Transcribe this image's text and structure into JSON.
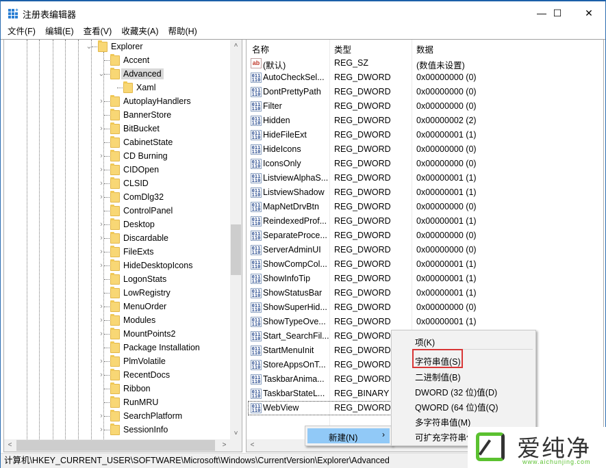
{
  "window": {
    "title": "注册表编辑器",
    "controls": {
      "minimize": "—",
      "maximize": "☐",
      "close": "✕"
    }
  },
  "menubar": [
    {
      "label": "文件(F)"
    },
    {
      "label": "编辑(E)"
    },
    {
      "label": "查看(V)"
    },
    {
      "label": "收藏夹(A)"
    },
    {
      "label": "帮助(H)"
    }
  ],
  "tree": {
    "items": [
      {
        "label": "Explorer",
        "level": 0,
        "expander": "expanded"
      },
      {
        "label": "Accent",
        "level": 1,
        "expander": "none"
      },
      {
        "label": "Advanced",
        "level": 1,
        "expander": "expanded",
        "selected": true
      },
      {
        "label": "Xaml",
        "level": 2,
        "expander": "none"
      },
      {
        "label": "AutoplayHandlers",
        "level": 1,
        "expander": "collapsed"
      },
      {
        "label": "BannerStore",
        "level": 1,
        "expander": "none"
      },
      {
        "label": "BitBucket",
        "level": 1,
        "expander": "collapsed"
      },
      {
        "label": "CabinetState",
        "level": 1,
        "expander": "none"
      },
      {
        "label": "CD Burning",
        "level": 1,
        "expander": "collapsed"
      },
      {
        "label": "CIDOpen",
        "level": 1,
        "expander": "collapsed"
      },
      {
        "label": "CLSID",
        "level": 1,
        "expander": "collapsed"
      },
      {
        "label": "ComDlg32",
        "level": 1,
        "expander": "collapsed"
      },
      {
        "label": "ControlPanel",
        "level": 1,
        "expander": "none"
      },
      {
        "label": "Desktop",
        "level": 1,
        "expander": "collapsed"
      },
      {
        "label": "Discardable",
        "level": 1,
        "expander": "collapsed"
      },
      {
        "label": "FileExts",
        "level": 1,
        "expander": "collapsed"
      },
      {
        "label": "HideDesktopIcons",
        "level": 1,
        "expander": "collapsed"
      },
      {
        "label": "LogonStats",
        "level": 1,
        "expander": "none"
      },
      {
        "label": "LowRegistry",
        "level": 1,
        "expander": "none"
      },
      {
        "label": "MenuOrder",
        "level": 1,
        "expander": "collapsed"
      },
      {
        "label": "Modules",
        "level": 1,
        "expander": "collapsed"
      },
      {
        "label": "MountPoints2",
        "level": 1,
        "expander": "collapsed"
      },
      {
        "label": "Package Installation",
        "level": 1,
        "expander": "none"
      },
      {
        "label": "PlmVolatile",
        "level": 1,
        "expander": "collapsed"
      },
      {
        "label": "RecentDocs",
        "level": 1,
        "expander": "collapsed"
      },
      {
        "label": "Ribbon",
        "level": 1,
        "expander": "none"
      },
      {
        "label": "RunMRU",
        "level": 1,
        "expander": "none"
      },
      {
        "label": "SearchPlatform",
        "level": 1,
        "expander": "collapsed"
      },
      {
        "label": "SessionInfo",
        "level": 1,
        "expander": "collapsed"
      }
    ]
  },
  "list": {
    "columns": {
      "name": "名称",
      "type": "类型",
      "data": "数据"
    },
    "rows": [
      {
        "icon": "string-value-icon",
        "name": "(默认)",
        "type": "REG_SZ",
        "data": "(数值未设置)"
      },
      {
        "icon": "binary-value-icon",
        "name": "AutoCheckSel...",
        "type": "REG_DWORD",
        "data": "0x00000000 (0)"
      },
      {
        "icon": "binary-value-icon",
        "name": "DontPrettyPath",
        "type": "REG_DWORD",
        "data": "0x00000000 (0)"
      },
      {
        "icon": "binary-value-icon",
        "name": "Filter",
        "type": "REG_DWORD",
        "data": "0x00000000 (0)"
      },
      {
        "icon": "binary-value-icon",
        "name": "Hidden",
        "type": "REG_DWORD",
        "data": "0x00000002 (2)"
      },
      {
        "icon": "binary-value-icon",
        "name": "HideFileExt",
        "type": "REG_DWORD",
        "data": "0x00000001 (1)"
      },
      {
        "icon": "binary-value-icon",
        "name": "HideIcons",
        "type": "REG_DWORD",
        "data": "0x00000000 (0)"
      },
      {
        "icon": "binary-value-icon",
        "name": "IconsOnly",
        "type": "REG_DWORD",
        "data": "0x00000000 (0)"
      },
      {
        "icon": "binary-value-icon",
        "name": "ListviewAlphaS...",
        "type": "REG_DWORD",
        "data": "0x00000001 (1)"
      },
      {
        "icon": "binary-value-icon",
        "name": "ListviewShadow",
        "type": "REG_DWORD",
        "data": "0x00000001 (1)"
      },
      {
        "icon": "binary-value-icon",
        "name": "MapNetDrvBtn",
        "type": "REG_DWORD",
        "data": "0x00000000 (0)"
      },
      {
        "icon": "binary-value-icon",
        "name": "ReindexedProf...",
        "type": "REG_DWORD",
        "data": "0x00000001 (1)"
      },
      {
        "icon": "binary-value-icon",
        "name": "SeparateProce...",
        "type": "REG_DWORD",
        "data": "0x00000000 (0)"
      },
      {
        "icon": "binary-value-icon",
        "name": "ServerAdminUI",
        "type": "REG_DWORD",
        "data": "0x00000000 (0)"
      },
      {
        "icon": "binary-value-icon",
        "name": "ShowCompCol...",
        "type": "REG_DWORD",
        "data": "0x00000001 (1)"
      },
      {
        "icon": "binary-value-icon",
        "name": "ShowInfoTip",
        "type": "REG_DWORD",
        "data": "0x00000001 (1)"
      },
      {
        "icon": "binary-value-icon",
        "name": "ShowStatusBar",
        "type": "REG_DWORD",
        "data": "0x00000001 (1)"
      },
      {
        "icon": "binary-value-icon",
        "name": "ShowSuperHid...",
        "type": "REG_DWORD",
        "data": "0x00000000 (0)"
      },
      {
        "icon": "binary-value-icon",
        "name": "ShowTypeOve...",
        "type": "REG_DWORD",
        "data": "0x00000001 (1)"
      },
      {
        "icon": "binary-value-icon",
        "name": "Start_SearchFil...",
        "type": "REG_DWORD",
        "data": ""
      },
      {
        "icon": "binary-value-icon",
        "name": "StartMenuInit",
        "type": "REG_DWORD",
        "data": ""
      },
      {
        "icon": "binary-value-icon",
        "name": "StoreAppsOnT...",
        "type": "REG_DWORD",
        "data": ""
      },
      {
        "icon": "binary-value-icon",
        "name": "TaskbarAnima...",
        "type": "REG_DWORD",
        "data": ""
      },
      {
        "icon": "binary-value-icon",
        "name": "TaskbarStateL...",
        "type": "REG_BINARY",
        "data": ""
      },
      {
        "icon": "binary-value-icon",
        "name": "WebView",
        "type": "REG_DWORD",
        "data": "",
        "focused": true
      }
    ]
  },
  "context_menu": {
    "main_item": {
      "label": "新建(N)",
      "arrow": "›"
    },
    "submenu": [
      {
        "label": "项(K)"
      },
      {
        "label": "字符串值(S)",
        "highlighted_box": true
      },
      {
        "label": "二进制值(B)"
      },
      {
        "label": "DWORD (32 位)值(D)"
      },
      {
        "label": "QWORD (64 位)值(Q)"
      },
      {
        "label": "多字符串值(M)"
      },
      {
        "label": "可扩充字符串值"
      }
    ]
  },
  "statusbar": {
    "path": "计算机\\HKEY_CURRENT_USER\\SOFTWARE\\Microsoft\\Windows\\CurrentVersion\\Explorer\\Advanced"
  },
  "watermark": {
    "text": "爱纯净",
    "url": "www.aichunjing.com",
    "accent": "#5bc130"
  },
  "colors": {
    "selection_bg": "#d9d9d9",
    "menu_highlight": "#91c9f7",
    "highlight_box": "#d83535",
    "folder": "#f8d775",
    "window_border": "#1b5fa8"
  },
  "scroll_icons": {
    "up": "˄",
    "down": "˅",
    "left": "<",
    "right": ">"
  },
  "tree_icons": {
    "expanded": "⌄",
    "collapsed": "›"
  }
}
